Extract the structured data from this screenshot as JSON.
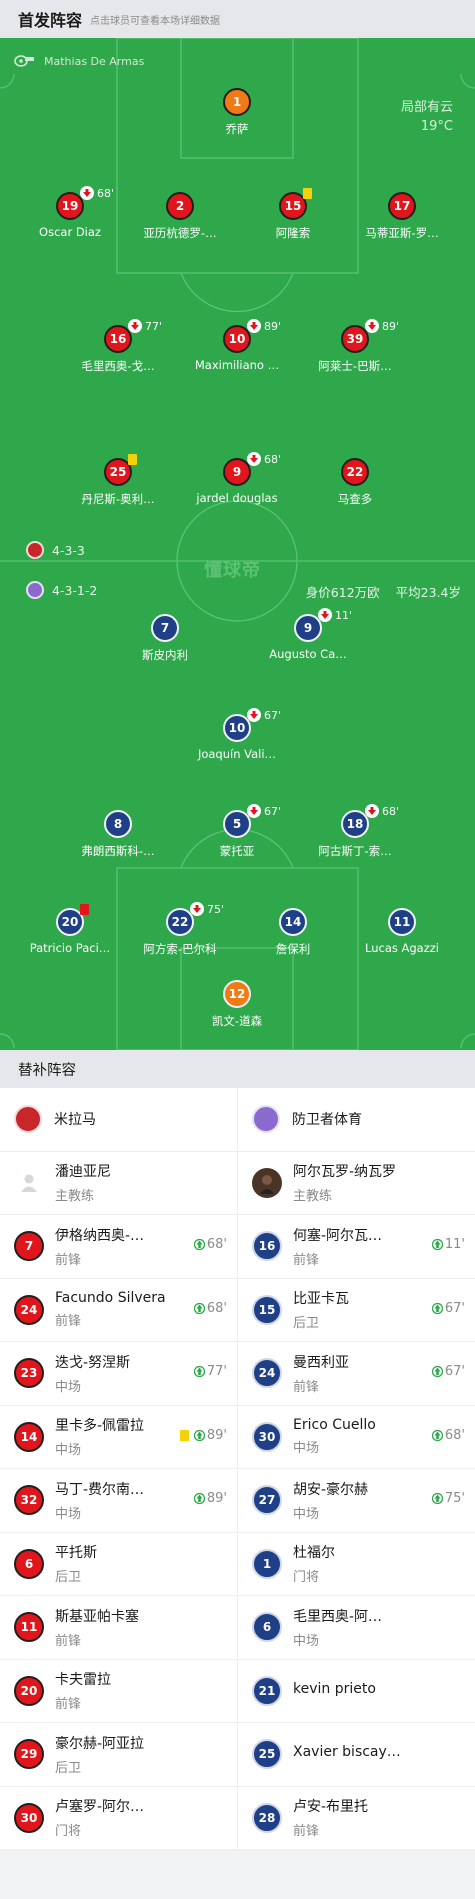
{
  "header": {
    "title": "首发阵容",
    "hint": "点击球员可查看本场详细数据"
  },
  "referee": {
    "name": "Mathias De Armas"
  },
  "weather": {
    "desc": "局部有云",
    "temp": "19°C"
  },
  "watermark": "懂球帝",
  "home": {
    "name": "米拉马",
    "formation": "4-3-3",
    "color": "#e0161c",
    "coach": "潘迪亚尼",
    "coach_role": "主教练"
  },
  "away": {
    "name": "防卫者体育",
    "formation": "4-3-1-2",
    "color": "#1f3f86",
    "value": "身价612万欧",
    "age": "平均23.4岁",
    "coach": "阿尔瓦罗-纳瓦罗",
    "coach_role": "主教练"
  },
  "home_players": [
    {
      "num": "1",
      "name": "乔萨",
      "gk": true
    },
    {
      "num": "19",
      "name": "Oscar Diaz",
      "sub": "68'"
    },
    {
      "num": "2",
      "name": "亚历杭德罗-…"
    },
    {
      "num": "15",
      "name": "阿隆索",
      "yellow": true
    },
    {
      "num": "17",
      "name": "马蒂亚斯-罗…"
    },
    {
      "num": "16",
      "name": "毛里西奥-戈…",
      "sub": "77'"
    },
    {
      "num": "10",
      "name": "Maximiliano …",
      "sub": "89'"
    },
    {
      "num": "39",
      "name": "阿莱士-巴斯…",
      "sub": "89'"
    },
    {
      "num": "25",
      "name": "丹尼斯-奥利…",
      "yellow": true
    },
    {
      "num": "9",
      "name": "jardel douglas",
      "sub": "68'"
    },
    {
      "num": "22",
      "name": "马查多"
    }
  ],
  "away_players": [
    {
      "num": "7",
      "name": "斯皮内利"
    },
    {
      "num": "9",
      "name": "Augusto Ca…",
      "sub": "11'"
    },
    {
      "num": "10",
      "name": "Joaquín Vali…",
      "sub": "67'"
    },
    {
      "num": "8",
      "name": "弗朗西斯科-…"
    },
    {
      "num": "5",
      "name": "蒙托亚",
      "sub": "67'"
    },
    {
      "num": "18",
      "name": "阿古斯丁-索…",
      "sub": "68'"
    },
    {
      "num": "20",
      "name": "Patricio Paci…",
      "red": true
    },
    {
      "num": "22",
      "name": "阿方索-巴尔科",
      "sub": "75'"
    },
    {
      "num": "14",
      "name": "詹保利"
    },
    {
      "num": "11",
      "name": "Lucas Agazzi"
    },
    {
      "num": "12",
      "name": "凯文-道森",
      "gk": true
    }
  ],
  "subs_title": "替补阵容",
  "bench": [
    {
      "l": {
        "num": "7",
        "name": "伊格纳西奥-…",
        "pos": "前锋",
        "min": "68'"
      },
      "r": {
        "num": "16",
        "name": "何塞-阿尔瓦…",
        "pos": "前锋",
        "min": "11'"
      }
    },
    {
      "l": {
        "num": "24",
        "name": "Facundo Silvera",
        "pos": "前锋",
        "min": "68'"
      },
      "r": {
        "num": "15",
        "name": "比亚卡瓦",
        "pos": "后卫",
        "min": "67'"
      }
    },
    {
      "l": {
        "num": "23",
        "name": "迭戈-努涅斯",
        "pos": "中场",
        "min": "77'"
      },
      "r": {
        "num": "24",
        "name": "曼西利亚",
        "pos": "前锋",
        "min": "67'"
      }
    },
    {
      "l": {
        "num": "14",
        "name": "里卡多-佩雷拉",
        "pos": "中场",
        "min": "89'",
        "yellow": true
      },
      "r": {
        "num": "30",
        "name": "Erico Cuello",
        "pos": "中场",
        "min": "68'"
      }
    },
    {
      "l": {
        "num": "32",
        "name": "马丁-费尔南…",
        "pos": "中场",
        "min": "89'"
      },
      "r": {
        "num": "27",
        "name": "胡安-豪尔赫",
        "pos": "中场",
        "min": "75'"
      }
    },
    {
      "l": {
        "num": "6",
        "name": "平托斯",
        "pos": "后卫"
      },
      "r": {
        "num": "1",
        "name": "杜福尔",
        "pos": "门将"
      }
    },
    {
      "l": {
        "num": "11",
        "name": "斯基亚帕卡塞",
        "pos": "前锋"
      },
      "r": {
        "num": "6",
        "name": "毛里西奥-阿…",
        "pos": "中场"
      }
    },
    {
      "l": {
        "num": "20",
        "name": "卡夫雷拉",
        "pos": "前锋"
      },
      "r": {
        "num": "21",
        "name": "kevin prieto",
        "pos": ""
      }
    },
    {
      "l": {
        "num": "29",
        "name": "豪尔赫-阿亚拉",
        "pos": "后卫"
      },
      "r": {
        "num": "25",
        "name": "Xavier biscay…",
        "pos": ""
      }
    },
    {
      "l": {
        "num": "30",
        "name": "卢塞罗-阿尔…",
        "pos": "门将"
      },
      "r": {
        "num": "28",
        "name": "卢安-布里托",
        "pos": "前锋"
      }
    }
  ]
}
